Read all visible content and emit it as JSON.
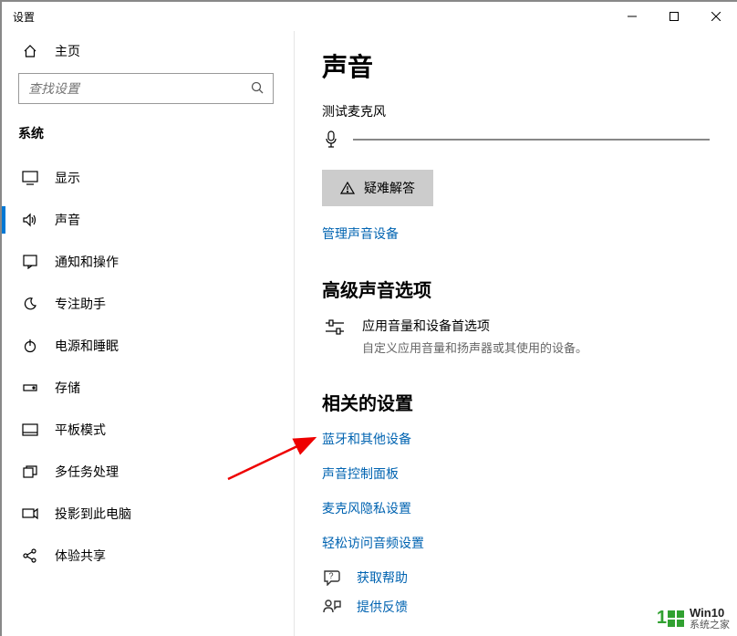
{
  "window": {
    "title": "设置"
  },
  "sidebar": {
    "home": "主页",
    "search_placeholder": "查找设置",
    "section_title": "系统",
    "items": [
      {
        "label": "显示"
      },
      {
        "label": "声音"
      },
      {
        "label": "通知和操作"
      },
      {
        "label": "专注助手"
      },
      {
        "label": "电源和睡眠"
      },
      {
        "label": "存储"
      },
      {
        "label": "平板模式"
      },
      {
        "label": "多任务处理"
      },
      {
        "label": "投影到此电脑"
      },
      {
        "label": "体验共享"
      }
    ]
  },
  "main": {
    "page_title": "声音",
    "test_mic_label": "测试麦克风",
    "troubleshoot_label": "疑难解答",
    "manage_devices_link": "管理声音设备",
    "advanced_section": "高级声音选项",
    "app_volume_title": "应用音量和设备首选项",
    "app_volume_desc": "自定义应用音量和扬声器或其使用的设备。",
    "related_section": "相关的设置",
    "related_links": [
      "蓝牙和其他设备",
      "声音控制面板",
      "麦克风隐私设置",
      "轻松访问音频设置"
    ],
    "get_help": "获取帮助",
    "give_feedback": "提供反馈"
  },
  "watermark": {
    "brand_num": "1",
    "line1": "Win10",
    "line2": "系统之家"
  }
}
